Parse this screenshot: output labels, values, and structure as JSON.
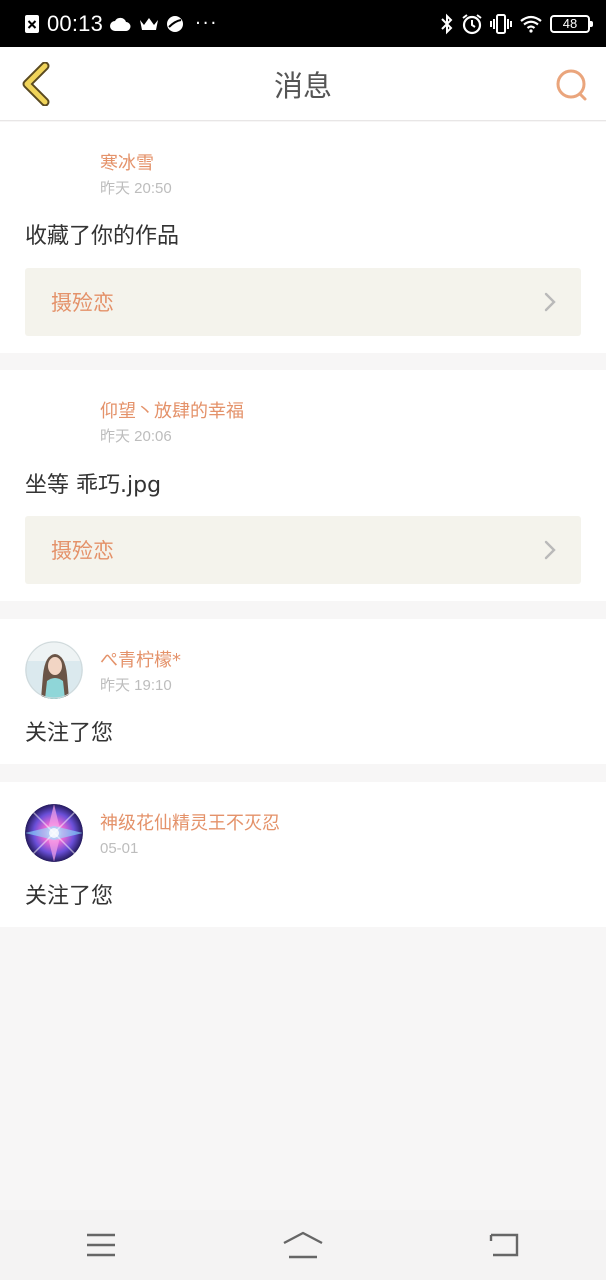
{
  "status_bar": {
    "time": "00:13",
    "battery": "48",
    "more": "···"
  },
  "header": {
    "title": "消息"
  },
  "colors": {
    "accent": "#e4926a",
    "work_box_bg": "#f4f3ec",
    "text": "#333333",
    "muted": "#bdbdbd"
  },
  "messages": [
    {
      "username": "寒冰雪",
      "time": "昨天 20:50",
      "content": "收藏了你的作品",
      "work_title": "摄殓恋",
      "avatar": "none"
    },
    {
      "username": "仰望丶放肆的幸福",
      "time": "昨天 20:06",
      "content": "坐等 乖巧.jpg",
      "work_title": "摄殓恋",
      "avatar": "none"
    },
    {
      "username": "ぺ青柠檬*",
      "time": "昨天 19:10",
      "content": "关注了您",
      "avatar": "girl-photo-avatar"
    },
    {
      "username": "神级花仙精灵王不灭忍",
      "time": "05-01",
      "content": "关注了您",
      "avatar": "kaleidoscope-avatar"
    }
  ],
  "icons": {
    "back": "chevron-left-icon",
    "search": "search-icon",
    "work_chevron": "chevron-right-icon",
    "nav_menu": "menu-icon",
    "nav_home": "home-icon",
    "nav_back": "return-icon"
  }
}
